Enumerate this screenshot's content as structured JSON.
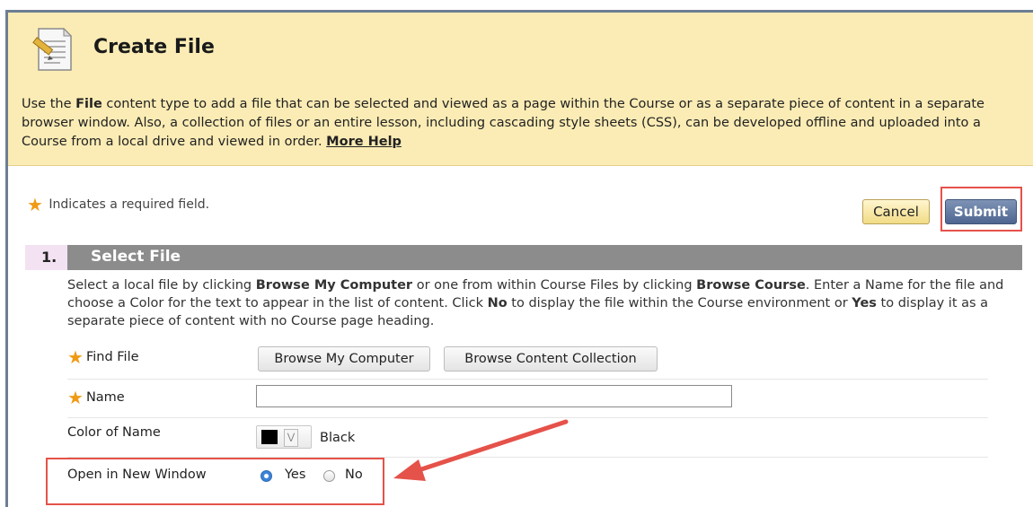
{
  "header": {
    "title": "Create File",
    "intro_part1": "Use the ",
    "intro_bold": "File",
    "intro_part2": " content type to add a file that can be selected and viewed as a page within the Course or as a separate piece of content in a separate browser window. Also, a collection of files or an entire lesson, including cascading style sheets (CSS), can be developed offline and uploaded into a Course from a local drive and viewed in order. ",
    "more_help": "More Help",
    "icon": "document-icon"
  },
  "required": {
    "star": "★",
    "text": "Indicates a required field."
  },
  "actions": {
    "cancel_label": "Cancel",
    "submit_label": "Submit"
  },
  "step": {
    "number": "1.",
    "title": "Select File",
    "desc": {
      "t1": "Select a local file by clicking ",
      "b1": "Browse My Computer",
      "t2": " or one from within Course Files by clicking ",
      "b2": "Browse Course",
      "t3": ". Enter a Name for the file and choose a Color for the text to appear in the list of content. Click ",
      "b3": "No",
      "t4": " to display the file within the Course environment or ",
      "b4": "Yes",
      "t5": " to display it as a separate piece of content with no Course page heading."
    }
  },
  "form": {
    "find_file_label": "Find File",
    "browse_computer_label": "Browse My Computer",
    "browse_collection_label": "Browse Content Collection",
    "name_label": "Name",
    "name_value": "",
    "color_label": "Color of Name",
    "color_value": "Black",
    "color_swatch": "#000000",
    "open_window_label": "Open in New Window",
    "yes_label": "Yes",
    "no_label": "No",
    "selected": "Yes"
  },
  "colors": {
    "header_bg": "#fbecb5",
    "accent_star": "#f09a14",
    "submit_bg": "#4e6690",
    "highlight": "#e5524a",
    "step_header_bg": "#8c8c8c"
  }
}
